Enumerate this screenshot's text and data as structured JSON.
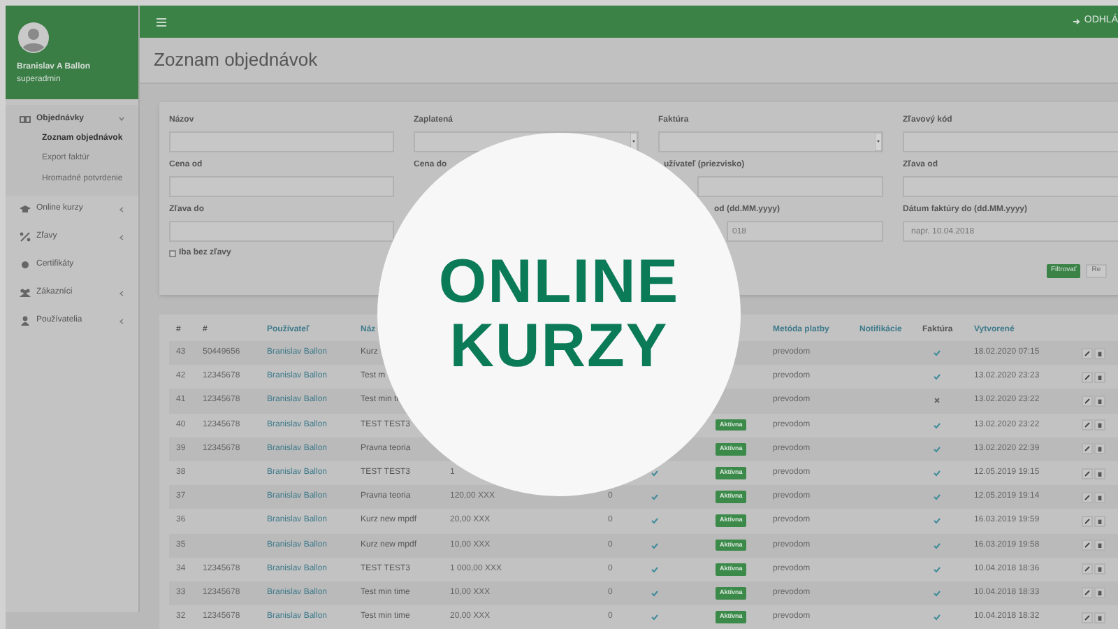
{
  "sidebar": {
    "user_name": "Branislav A Ballon",
    "role": "superadmin",
    "items": [
      {
        "label": "Objednávky",
        "expanded": true,
        "children": [
          {
            "label": "Zoznam objednávok",
            "selected": true
          },
          {
            "label": "Export faktúr",
            "selected": false
          },
          {
            "label": "Hromadné potvrdenie",
            "selected": false
          }
        ]
      },
      {
        "label": "Online kurzy",
        "expanded": false
      },
      {
        "label": "Zľavy",
        "expanded": false
      },
      {
        "label": "Certifikáty"
      },
      {
        "label": "Zákazníci",
        "expanded": false
      },
      {
        "label": "Používatelia",
        "expanded": false
      }
    ]
  },
  "topbar": {
    "logout": "ODHLÁ"
  },
  "page_title": "Zoznam objednávok",
  "filters": {
    "fields": [
      {
        "label": "Názov",
        "kind": "text"
      },
      {
        "label": "Zaplatená",
        "kind": "select"
      },
      {
        "label": "Faktúra",
        "kind": "select"
      },
      {
        "label": "Zľavový kód",
        "kind": "text"
      },
      {
        "label": "Cena od",
        "kind": "text"
      },
      {
        "label": "Cena do",
        "kind": "text"
      },
      {
        "label": "užívateľ (priezvisko)",
        "kind": "text"
      },
      {
        "label": "Zľava od",
        "kind": "text"
      },
      {
        "label": "Zľava do",
        "kind": "text"
      },
      {
        "kind": "empty"
      },
      {
        "label": "od (dd.MM.yyyy)",
        "kind": "text",
        "placeholder": "018"
      },
      {
        "label": "Dátum faktúry do (dd.MM.yyyy)",
        "kind": "text",
        "placeholder": "napr. 10.04.2018"
      }
    ],
    "checkbox": {
      "label": "Iba bez zľavy",
      "checked": false
    },
    "buttons": [
      "Filtrovať",
      "Re"
    ]
  },
  "table": {
    "columns": [
      "#",
      "#",
      "Používateľ",
      "Náz",
      "",
      "",
      "",
      "",
      "Metóda platby",
      "Notifikácie",
      "Faktúra",
      "Vytvorené"
    ],
    "rows": [
      {
        "id": "43",
        "number": "50449656",
        "user": "Branislav Ballon",
        "name": "Kurz",
        "method": "prevodom",
        "invoice": true,
        "created": "18.02.2020 07:15"
      },
      {
        "id": "42",
        "number": "12345678",
        "user": "Branislav Ballon",
        "name": "Test m",
        "method": "prevodom",
        "invoice": true,
        "created": "13.02.2020 23:23"
      },
      {
        "id": "41",
        "number": "12345678",
        "user": "Branislav Ballon",
        "name": "Test min ti",
        "method": "prevodom",
        "invoice": false,
        "created": "13.02.2020 23:22"
      },
      {
        "id": "40",
        "number": "12345678",
        "user": "Branislav Ballon",
        "name": "TEST TEST3",
        "status": "Aktívna",
        "method": "prevodom",
        "invoice": true,
        "created": "13.02.2020 23:22"
      },
      {
        "id": "39",
        "number": "12345678",
        "user": "Branislav Ballon",
        "name": "Pravna teoria",
        "status": "Aktívna",
        "method": "prevodom",
        "invoice": true,
        "created": "13.02.2020 22:39"
      },
      {
        "id": "38",
        "user": "Branislav Ballon",
        "name": "TEST TEST3",
        "price": "1",
        "paid": true,
        "status": "Aktívna",
        "method": "prevodom",
        "invoice": true,
        "created": "12.05.2019 19:15"
      },
      {
        "id": "37",
        "user": "Branislav Ballon",
        "name": "Pravna teoria",
        "price": "120,00 XXX",
        "count": "0",
        "paid": true,
        "status": "Aktívna",
        "method": "prevodom",
        "invoice": true,
        "created": "12.05.2019 19:14"
      },
      {
        "id": "36",
        "user": "Branislav Ballon",
        "name": "Kurz new mpdf",
        "price": "20,00 XXX",
        "count": "0",
        "paid": true,
        "status": "Aktívna",
        "method": "prevodom",
        "invoice": true,
        "created": "16.03.2019 19:59"
      },
      {
        "id": "35",
        "user": "Branislav Ballon",
        "name": "Kurz new mpdf",
        "price": "10,00 XXX",
        "count": "0",
        "paid": true,
        "status": "Aktívna",
        "method": "prevodom",
        "invoice": true,
        "created": "16.03.2019 19:58"
      },
      {
        "id": "34",
        "number": "12345678",
        "user": "Branislav Ballon",
        "name": "TEST TEST3",
        "price": "1 000,00 XXX",
        "count": "0",
        "paid": true,
        "status": "Aktívna",
        "method": "prevodom",
        "invoice": true,
        "created": "10.04.2018 18:36"
      },
      {
        "id": "33",
        "number": "12345678",
        "user": "Branislav Ballon",
        "name": "Test min time",
        "price": "10,00 XXX",
        "count": "0",
        "paid": true,
        "status": "Aktívna",
        "method": "prevodom",
        "invoice": true,
        "created": "10.04.2018 18:33"
      },
      {
        "id": "32",
        "number": "12345678",
        "user": "Branislav Ballon",
        "name": "Test min time",
        "price": "20,00 XXX",
        "count": "0",
        "paid": true,
        "status": "Aktívna",
        "method": "prevodom",
        "invoice": true,
        "created": "10.04.2018 18:32"
      }
    ]
  },
  "overlay": {
    "lines": [
      "ONLINE",
      "KURZY"
    ]
  }
}
